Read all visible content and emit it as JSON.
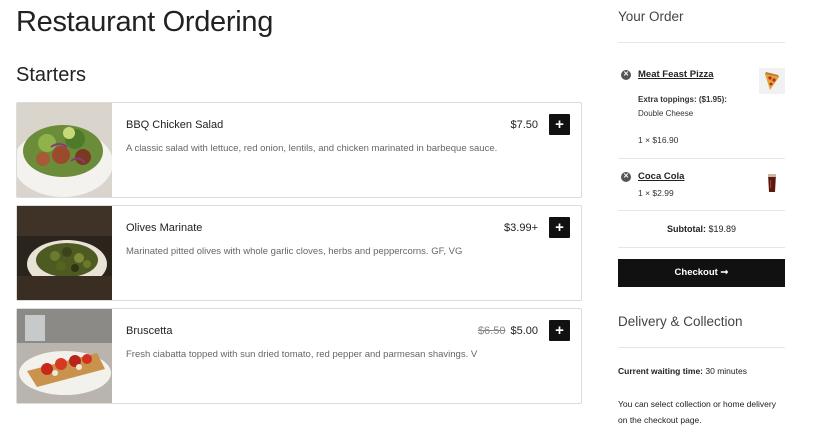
{
  "page": {
    "title": "Restaurant Ordering"
  },
  "menu": {
    "section_title": "Starters",
    "items": [
      {
        "name": "BBQ Chicken Salad",
        "description": "A classic salad with lettuce, red onion, lentils, and chicken marinated in barbeque sauce.",
        "price": "$7.50",
        "old_price": "",
        "add_label": "+"
      },
      {
        "name": "Olives Marinate",
        "description": "Marinated pitted olives with whole garlic cloves, herbs and peppercorns. GF, VG",
        "price": "$3.99+",
        "old_price": "",
        "add_label": "+"
      },
      {
        "name": "Bruscetta",
        "description": "Fresh ciabatta topped with sun dried tomato, red pepper and parmesan shavings. V",
        "price": "$5.00",
        "old_price": "$6.50",
        "add_label": "+"
      }
    ]
  },
  "order": {
    "title": "Your Order",
    "lines": [
      {
        "name": "Meat Feast Pizza",
        "extras_label": "Extra toppings: ($1.95):",
        "extras_value": "Double Cheese",
        "qty_price": "1 × $16.90",
        "thumb_icon": "pizza-slice-icon"
      },
      {
        "name": "Coca Cola",
        "qty_price": "1 × $2.99",
        "thumb_icon": "cola-glass-icon"
      }
    ],
    "subtotal_label": "Subtotal:",
    "subtotal_value": "$19.89",
    "checkout_label": "Checkout ➞"
  },
  "delivery": {
    "title": "Delivery & Collection",
    "wait_label": "Current waiting time:",
    "wait_value": "30 minutes",
    "note": "You can select collection or home delivery on the checkout page."
  },
  "colors": {
    "button_bg": "#111111",
    "card_border": "#dcdcdc"
  }
}
